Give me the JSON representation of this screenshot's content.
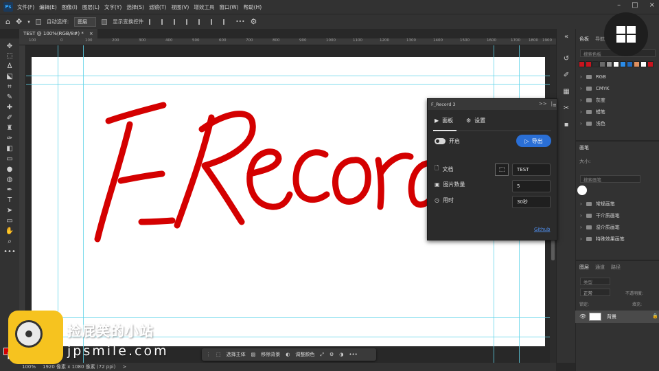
{
  "app": {
    "logo": "Ps"
  },
  "menubar": {
    "items": [
      "文件(F)",
      "编辑(E)",
      "图像(I)",
      "图层(L)",
      "文字(Y)",
      "选择(S)",
      "滤镜(T)",
      "视图(V)",
      "增效工具",
      "窗口(W)",
      "帮助(H)"
    ]
  },
  "options": {
    "auto_select_label": "自动选择:",
    "layer_select_value": "图层",
    "show_transform_label": "显示变换控件",
    "more_label": "•••"
  },
  "document": {
    "tab_title": "TEST @ 100%(RGB/8#) *",
    "close": "×"
  },
  "ruler": {
    "top_labels": [
      "100",
      "0",
      "100",
      "200",
      "300",
      "400",
      "500",
      "600",
      "700",
      "800",
      "900",
      "1000",
      "1100",
      "1200",
      "1300",
      "1400",
      "1500",
      "1600",
      "1700",
      "1800",
      "1900"
    ]
  },
  "status": {
    "zoom": "100%",
    "info": "1920 像素 x 1080 像素 (72 ppi)",
    "arrow": ">"
  },
  "contextbar": {
    "select_subject": "选择主体",
    "remove_bg": "移除背景",
    "adjust_color": "调整颜色",
    "more": "•••"
  },
  "frecord": {
    "title": "F_Record 3",
    "collapse": ">>",
    "close": "|",
    "menu": "≡",
    "tab_panel": "面板",
    "tab_settings": "设置",
    "toggle_label": "开启",
    "export_label": "导出",
    "doc_label": "文档",
    "count_label": "图片数量",
    "time_label": "用时",
    "doc_value": "TEST",
    "count_value": "5",
    "time_value": "30秒",
    "github_link": "Github"
  },
  "canvas": {
    "handwriting": "F_Record",
    "handwriting_color": "#d40000"
  },
  "right_panel": {
    "tab_swatches": "色板",
    "tab_other": "导航",
    "search_placeholder": "搜索色板",
    "swatch_colors": [
      "#c8141e",
      "#c8141e",
      "#2e2e2e",
      "#6a6a6a",
      "#9a9a9a",
      "#ffffff",
      "#2b8ce8",
      "#1f6bc0",
      "#e09060",
      "#ffffff",
      "#c8141e",
      "#c8141e"
    ],
    "swatch_groups": [
      "RGB",
      "CMYK",
      "灰度",
      "蜡笔",
      "浅色"
    ],
    "brush_tab": "画笔",
    "brush_size_label": "大小:",
    "brush_search": "搜索画笔",
    "brush_groups": [
      "常规画笔",
      "干介质画笔",
      "湿介质画笔",
      "特殊效果画笔"
    ],
    "layers_tab": "图层",
    "channels_tab": "通道",
    "paths_tab": "路径",
    "layer_search": "类型",
    "blend_mode": "正常",
    "opacity_label": "不透明度:",
    "lock_label": "锁定:",
    "fill_label": "填充:",
    "layer_name": "背景"
  },
  "watermark": {
    "name": "捡屁笑的小站",
    "domain": "jpsmile.com"
  },
  "colors": {
    "foreground": "#d40000",
    "background": "#ffffff",
    "accent": "#2a6fd6"
  }
}
